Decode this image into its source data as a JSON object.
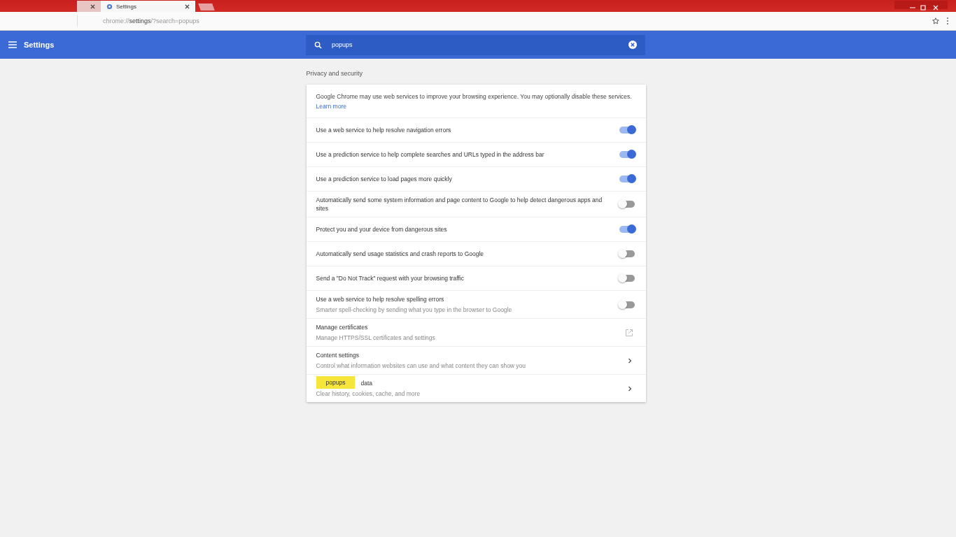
{
  "browser": {
    "tabs": [
      {
        "selected": false
      },
      {
        "title": "Settings",
        "selected": true
      }
    ],
    "address": {
      "scheme": "chrome://",
      "host": "settings",
      "rest": "/?search=popups"
    }
  },
  "header": {
    "title": "Settings",
    "search": {
      "value": "popups"
    }
  },
  "section": {
    "heading": "Privacy and security",
    "intro": {
      "text": "Google Chrome may use web services to improve your browsing experience. You may optionally disable these services.",
      "link": "Learn more"
    },
    "rows": [
      {
        "kind": "toggle",
        "title": "Use a web service to help resolve navigation errors",
        "on": true
      },
      {
        "kind": "toggle",
        "title": "Use a prediction service to help complete searches and URLs typed in the address bar",
        "on": true
      },
      {
        "kind": "toggle",
        "title": "Use a prediction service to load pages more quickly",
        "on": true
      },
      {
        "kind": "toggle",
        "title": "Automatically send some system information and page content to Google to help detect dangerous apps and sites",
        "on": false
      },
      {
        "kind": "toggle",
        "title": "Protect you and your device from dangerous sites",
        "on": true
      },
      {
        "kind": "toggle",
        "title": "Automatically send usage statistics and crash reports to Google",
        "on": false
      },
      {
        "kind": "toggle",
        "title": "Send a \"Do Not Track\" request with your browsing traffic",
        "on": false
      },
      {
        "kind": "toggle",
        "title": "Use a web service to help resolve spelling errors",
        "subtitle": "Smarter spell-checking by sending what you type in the browser to Google",
        "on": false
      },
      {
        "kind": "external",
        "title": "Manage certificates",
        "subtitle": "Manage HTTPS/SSL certificates and settings"
      },
      {
        "kind": "arrow",
        "title": "Content settings",
        "subtitle": "Control what information websites can use and what content they can show you"
      },
      {
        "kind": "arrow",
        "title": "data",
        "subtitle": "Clear history, cookies, cache, and more",
        "bubble": "popups"
      }
    ]
  }
}
